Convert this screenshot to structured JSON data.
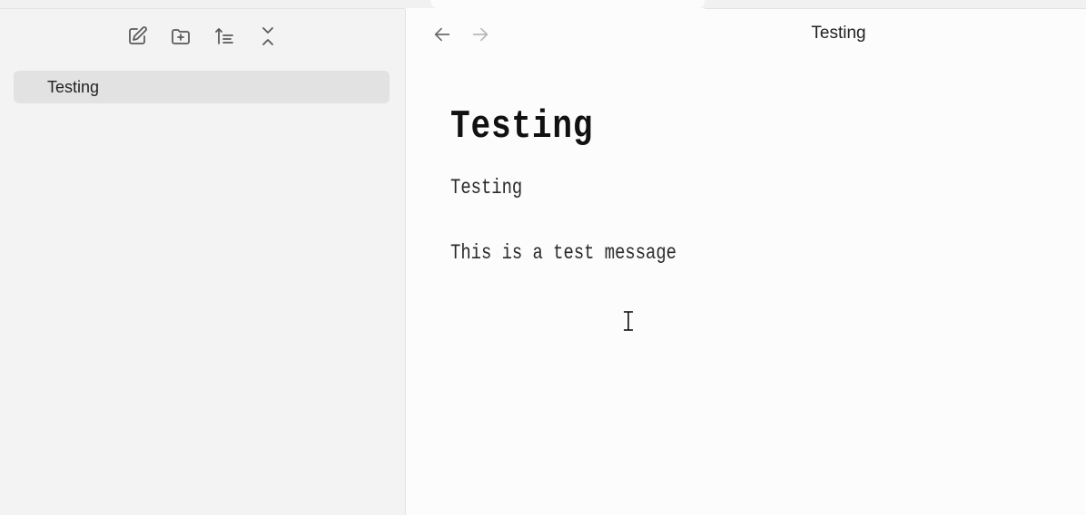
{
  "sidebar": {
    "toolbar": [
      {
        "name": "new-note",
        "icon": "edit-icon"
      },
      {
        "name": "new-folder",
        "icon": "folder-plus-icon"
      },
      {
        "name": "sort",
        "icon": "sort-icon"
      },
      {
        "name": "collapse",
        "icon": "collapse-icon"
      }
    ],
    "files": [
      {
        "label": "Testing"
      }
    ]
  },
  "main": {
    "view_title": "Testing",
    "document": {
      "heading": "Testing",
      "paragraphs": [
        "Testing",
        "This is a test message"
      ]
    }
  },
  "colors": {
    "sidebar_bg": "#f3f3f3",
    "main_bg": "#fcfcfc",
    "selected_item_bg": "#e2e2e2",
    "icon": "#5a5a5a"
  }
}
